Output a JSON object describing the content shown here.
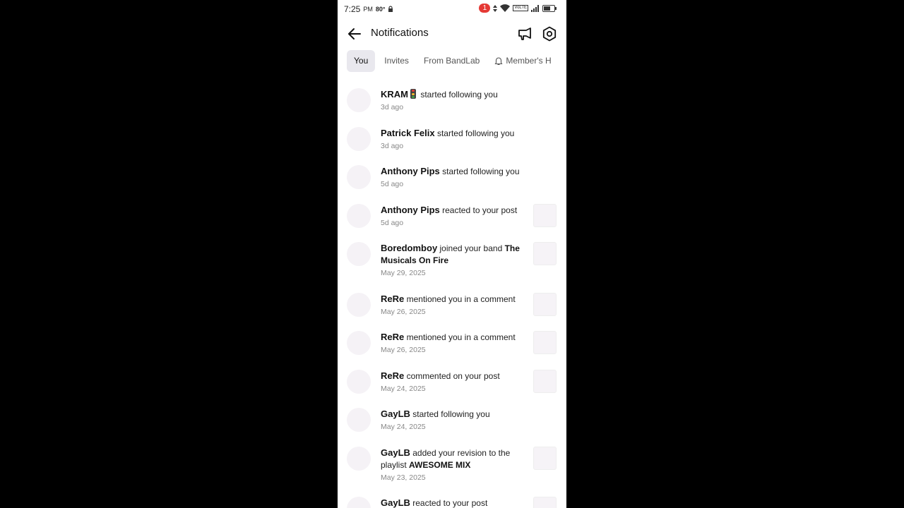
{
  "status_bar": {
    "time": "7:25",
    "ampm": "PM",
    "temp": "80°",
    "notification_count": "1",
    "network_label": "VoLTE"
  },
  "header": {
    "title": "Notifications"
  },
  "tabs": [
    {
      "label": "You",
      "active": true
    },
    {
      "label": "Invites",
      "active": false
    },
    {
      "label": "From BandLab",
      "active": false
    },
    {
      "label": "Member's H",
      "active": false
    }
  ],
  "notifications": [
    {
      "name": "KRAM",
      "emoji": "traffic-light-icon",
      "action": "started following you",
      "extra": "",
      "time": "3d ago",
      "thumb": false
    },
    {
      "name": "Patrick Felix",
      "action": "started following you",
      "extra": "",
      "time": "3d ago",
      "thumb": false
    },
    {
      "name": "Anthony Pips",
      "action": "started following you",
      "extra": "",
      "time": "5d ago",
      "thumb": false
    },
    {
      "name": "Anthony Pips",
      "action": "reacted to your post",
      "extra": "",
      "time": "5d ago",
      "thumb": true
    },
    {
      "name": "Boredomboy",
      "action": "joined your band",
      "extra": "The Musicals On Fire",
      "time": "May 29, 2025",
      "thumb": true
    },
    {
      "name": "ReRe",
      "action": "mentioned you in a comment",
      "extra": "",
      "time": "May 26, 2025",
      "thumb": true
    },
    {
      "name": "ReRe",
      "action": "mentioned you in a comment",
      "extra": "",
      "time": "May 26, 2025",
      "thumb": true
    },
    {
      "name": "ReRe",
      "action": "commented on your post",
      "extra": "",
      "time": "May 24, 2025",
      "thumb": true
    },
    {
      "name": "GayLB",
      "action": "started following you",
      "extra": "",
      "time": "May 24, 2025",
      "thumb": false
    },
    {
      "name": "GayLB",
      "action": "added your revision to the playlist",
      "extra": "AWESOME MIX",
      "time": "May 23, 2025",
      "thumb": true
    },
    {
      "name": "GayLB",
      "action": "reacted to your post",
      "extra": "",
      "time": "",
      "thumb": true
    }
  ],
  "colors": {
    "background": "#000000",
    "screen": "#ffffff",
    "active_tab": "#e9e8ee",
    "badge": "#e53935",
    "placeholder": "#f5f2f6"
  }
}
